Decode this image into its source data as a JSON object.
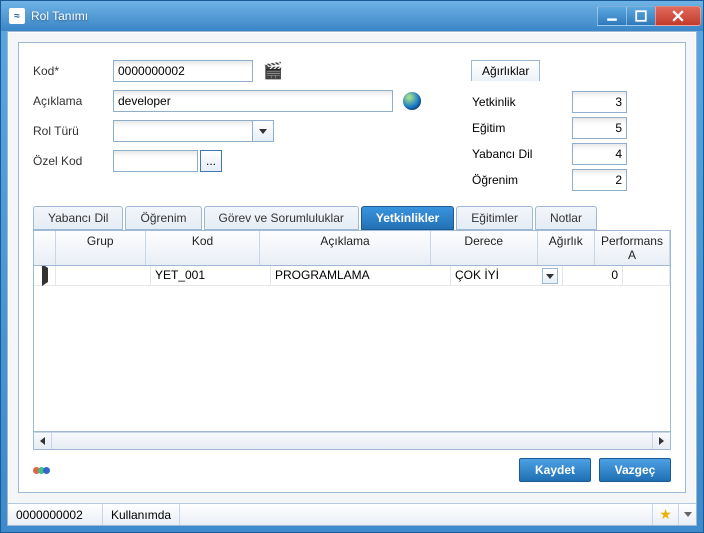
{
  "window": {
    "title": "Rol Tanımı"
  },
  "form": {
    "kod_label": "Kod*",
    "kod_value": "0000000002",
    "aciklama_label": "Açıklama",
    "aciklama_value": "developer",
    "rolturu_label": "Rol Türü",
    "rolturu_value": "",
    "ozelkod_label": "Özel Kod",
    "ozelkod_value": ""
  },
  "weights": {
    "header": "Ağırlıklar",
    "items": [
      {
        "label": "Yetkinlik",
        "value": "3"
      },
      {
        "label": "Eğitim",
        "value": "5"
      },
      {
        "label": "Yabancı Dil",
        "value": "4"
      },
      {
        "label": "Öğrenim",
        "value": "2"
      }
    ]
  },
  "tabs": {
    "yabanci": "Yabancı Dil",
    "ogrenim": "Öğrenim",
    "gorev": "Görev ve Sorumluluklar",
    "yetkinlik": "Yetkinlikler",
    "egitim": "Eğitimler",
    "notlar": "Notlar"
  },
  "grid": {
    "headers": {
      "grup": "Grup",
      "kod": "Kod",
      "aciklama": "Açıklama",
      "derece": "Derece",
      "agirlik": "Ağırlık",
      "perf": "Performans A"
    },
    "rows": [
      {
        "grup": "",
        "kod": "YET_001",
        "aciklama": "PROGRAMLAMA",
        "derece": "ÇOK İYİ",
        "agirlik": "0",
        "perf": ""
      }
    ]
  },
  "buttons": {
    "kaydet": "Kaydet",
    "vazgec": "Vazgeç",
    "ozel_more": "..."
  },
  "status": {
    "code": "0000000002",
    "state": "Kullanımda"
  }
}
